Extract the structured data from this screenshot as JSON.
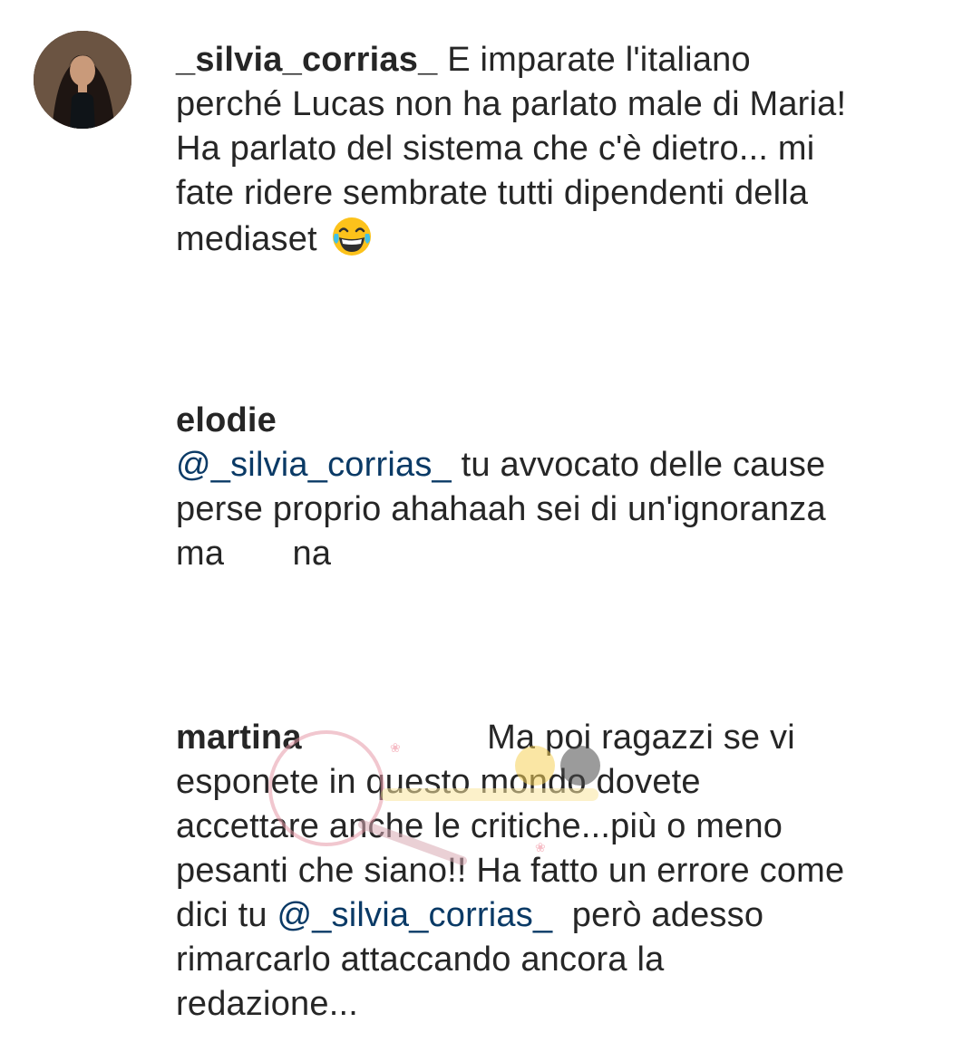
{
  "comments": [
    {
      "username": "_silvia_corrias_",
      "text": " E imparate l'italiano perché Lucas non ha parlato male di Maria! Ha parlato del sistema che c'è dietro... mi fate ridere sembrate tutti dipendenti della mediaset ",
      "emoji": "face-with-tears-of-joy-icon"
    },
    {
      "username": "elodie",
      "mention": "@_silvia_corrias_",
      "text_after_mention": " tu avvocato delle cause perse proprio ahahaah sei di un'ignoranza ma       na"
    },
    {
      "username": "martina",
      "text_part1": "                   Ma poi ragazzi se vi esponete in questo mondo dovete accettare anche le critiche...più o meno pesanti che siano!! Ha fatto un errore come dici tu ",
      "mention": "@_silvia_corrias_",
      "text_part2": "  però adesso rimarcarlo attaccando ancora la redazione..."
    }
  ],
  "colors": {
    "text": "#262626",
    "mention": "#0a3a66",
    "background": "#ffffff"
  }
}
